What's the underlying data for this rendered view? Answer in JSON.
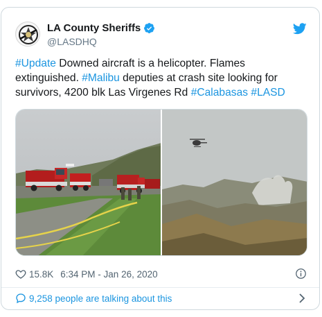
{
  "account": {
    "name": "LA County Sheriffs",
    "handle": "@LASDHQ"
  },
  "tweet": {
    "segments": [
      {
        "type": "hashtag",
        "text": "#Update"
      },
      {
        "type": "text",
        "text": " Downed aircraft is a helicopter. Flames extinguished. "
      },
      {
        "type": "hashtag",
        "text": "#Malibu"
      },
      {
        "type": "text",
        "text": " deputies at crash site looking for survivors, 4200 blk Las Virgenes Rd "
      },
      {
        "type": "hashtag",
        "text": "#Calabasas"
      },
      {
        "type": "text",
        "text": " "
      },
      {
        "type": "hashtag",
        "text": "#LASD"
      }
    ]
  },
  "media": {
    "left_photo": "fire-trucks-on-road",
    "right_photo": "helicopter-over-smoke-hills"
  },
  "meta": {
    "likes": "15.8K",
    "timestamp": "6:34 PM - Jan 26, 2020"
  },
  "footer": {
    "talking": "9,258 people are talking about this"
  },
  "colors": {
    "link": "#1b95e0",
    "verified": "#1da1f2",
    "border": "#cfd9de",
    "muted": "#657786"
  },
  "icons": {
    "verified": "verified-badge-icon",
    "bird": "twitter-bird-icon",
    "heart": "heart-icon",
    "info": "info-icon",
    "bubble": "speech-bubble-icon",
    "chevron": "chevron-right-icon"
  }
}
